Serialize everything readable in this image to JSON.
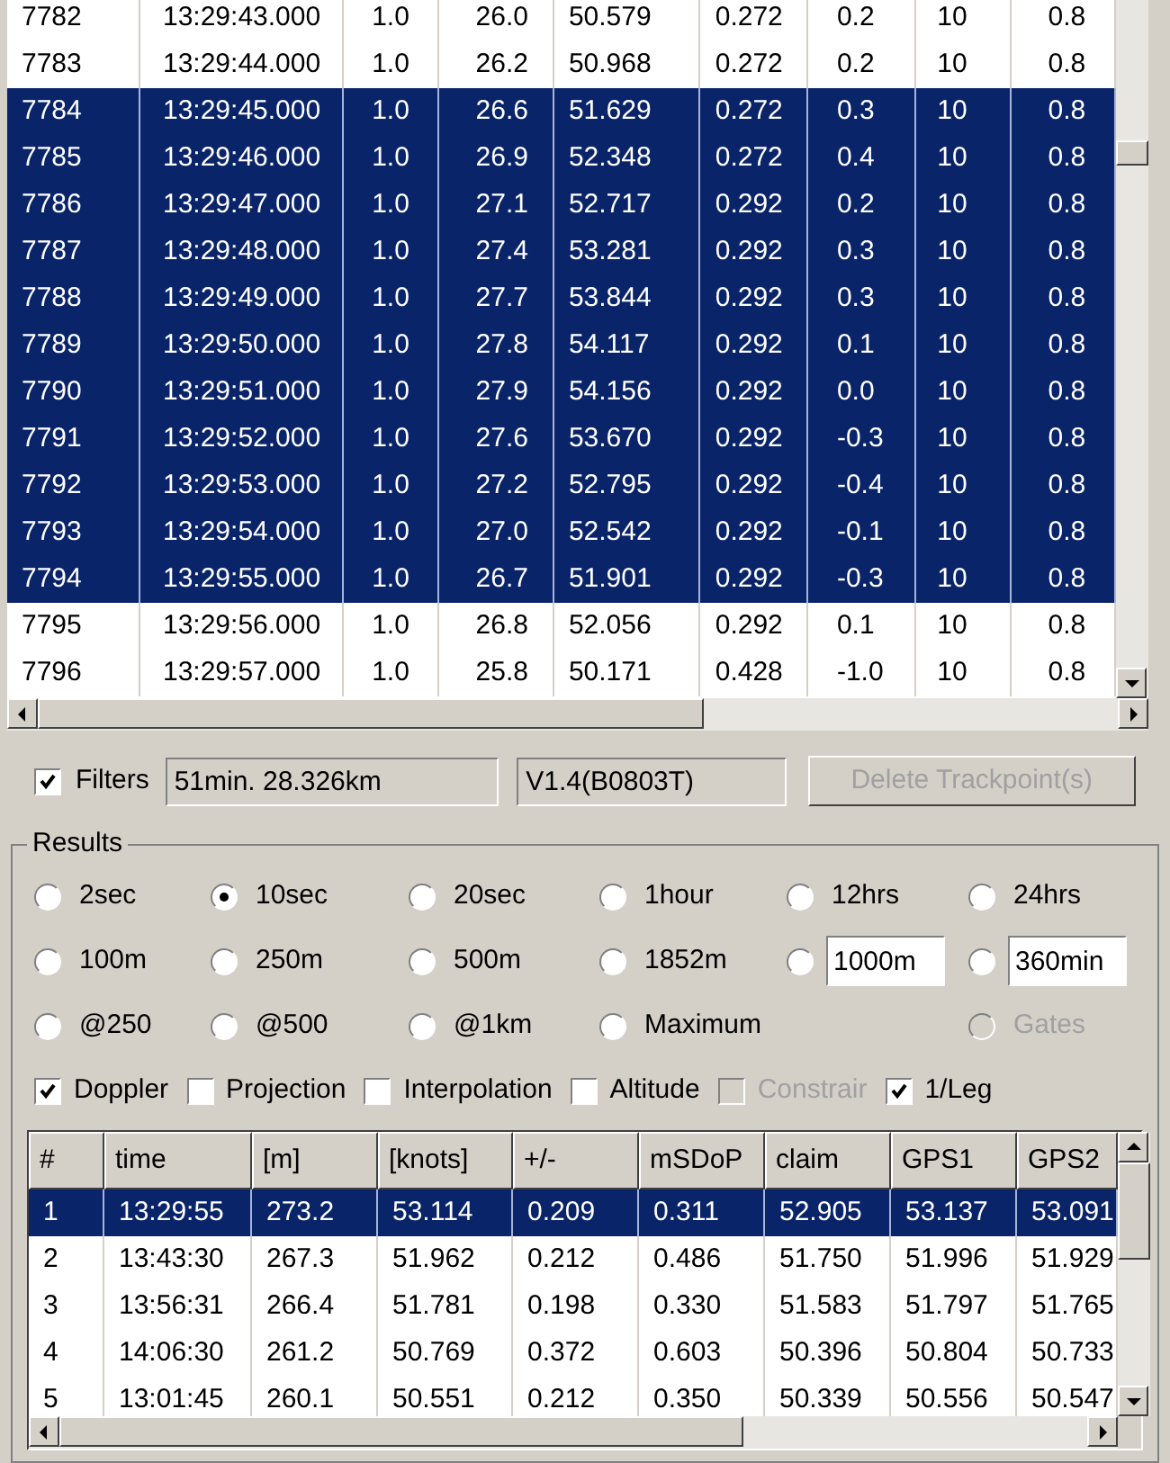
{
  "track_table": {
    "rows": [
      {
        "selected": false,
        "cells": [
          "7782",
          "13:29:43.000",
          "1.0",
          "26.0",
          "50.579",
          "0.272",
          "0.2",
          "10",
          "0.8"
        ]
      },
      {
        "selected": false,
        "cells": [
          "7783",
          "13:29:44.000",
          "1.0",
          "26.2",
          "50.968",
          "0.272",
          "0.2",
          "10",
          "0.8"
        ]
      },
      {
        "selected": true,
        "cells": [
          "7784",
          "13:29:45.000",
          "1.0",
          "26.6",
          "51.629",
          "0.272",
          "0.3",
          "10",
          "0.8"
        ]
      },
      {
        "selected": true,
        "cells": [
          "7785",
          "13:29:46.000",
          "1.0",
          "26.9",
          "52.348",
          "0.272",
          "0.4",
          "10",
          "0.8"
        ]
      },
      {
        "selected": true,
        "cells": [
          "7786",
          "13:29:47.000",
          "1.0",
          "27.1",
          "52.717",
          "0.292",
          "0.2",
          "10",
          "0.8"
        ]
      },
      {
        "selected": true,
        "cells": [
          "7787",
          "13:29:48.000",
          "1.0",
          "27.4",
          "53.281",
          "0.292",
          "0.3",
          "10",
          "0.8"
        ]
      },
      {
        "selected": true,
        "cells": [
          "7788",
          "13:29:49.000",
          "1.0",
          "27.7",
          "53.844",
          "0.292",
          "0.3",
          "10",
          "0.8"
        ]
      },
      {
        "selected": true,
        "cells": [
          "7789",
          "13:29:50.000",
          "1.0",
          "27.8",
          "54.117",
          "0.292",
          "0.1",
          "10",
          "0.8"
        ]
      },
      {
        "selected": true,
        "cells": [
          "7790",
          "13:29:51.000",
          "1.0",
          "27.9",
          "54.156",
          "0.292",
          "0.0",
          "10",
          "0.8"
        ]
      },
      {
        "selected": true,
        "cells": [
          "7791",
          "13:29:52.000",
          "1.0",
          "27.6",
          "53.670",
          "0.292",
          "-0.3",
          "10",
          "0.8"
        ]
      },
      {
        "selected": true,
        "cells": [
          "7792",
          "13:29:53.000",
          "1.0",
          "27.2",
          "52.795",
          "0.292",
          "-0.4",
          "10",
          "0.8"
        ]
      },
      {
        "selected": true,
        "cells": [
          "7793",
          "13:29:54.000",
          "1.0",
          "27.0",
          "52.542",
          "0.292",
          "-0.1",
          "10",
          "0.8"
        ]
      },
      {
        "selected": true,
        "cells": [
          "7794",
          "13:29:55.000",
          "1.0",
          "26.7",
          "51.901",
          "0.292",
          "-0.3",
          "10",
          "0.8"
        ]
      },
      {
        "selected": false,
        "cells": [
          "7795",
          "13:29:56.000",
          "1.0",
          "26.8",
          "52.056",
          "0.292",
          "0.1",
          "10",
          "0.8"
        ]
      },
      {
        "selected": false,
        "cells": [
          "7796",
          "13:29:57.000",
          "1.0",
          "25.8",
          "50.171",
          "0.428",
          "-1.0",
          "10",
          "0.8"
        ]
      }
    ]
  },
  "filters": {
    "label": "Filters",
    "checked": true
  },
  "summary_field": {
    "value": "51min. 28.326km"
  },
  "version_field": {
    "value": "V1.4(B0803T)"
  },
  "delete_button": {
    "label": "Delete Trackpoint(s)",
    "disabled": true
  },
  "results": {
    "title": "Results",
    "options": [
      {
        "kind": "radio",
        "label": "2sec",
        "selected": false,
        "disabled": false
      },
      {
        "kind": "radio",
        "label": "10sec",
        "selected": true,
        "disabled": false
      },
      {
        "kind": "radio",
        "label": "20sec",
        "selected": false,
        "disabled": false
      },
      {
        "kind": "radio",
        "label": "1hour",
        "selected": false,
        "disabled": false
      },
      {
        "kind": "radio",
        "label": "12hrs",
        "selected": false,
        "disabled": false
      },
      {
        "kind": "radio",
        "label": "24hrs",
        "selected": false,
        "disabled": false
      },
      {
        "kind": "radio",
        "label": "100m",
        "selected": false,
        "disabled": false
      },
      {
        "kind": "radio",
        "label": "250m",
        "selected": false,
        "disabled": false
      },
      {
        "kind": "radio",
        "label": "500m",
        "selected": false,
        "disabled": false
      },
      {
        "kind": "radio",
        "label": "1852m",
        "selected": false,
        "disabled": false
      },
      {
        "kind": "input",
        "value": "1000m",
        "selected": false,
        "disabled": false
      },
      {
        "kind": "input",
        "value": "360min",
        "selected": false,
        "disabled": false
      },
      {
        "kind": "radio",
        "label": "@250",
        "selected": false,
        "disabled": false
      },
      {
        "kind": "radio",
        "label": "@500",
        "selected": false,
        "disabled": false
      },
      {
        "kind": "radio",
        "label": "@1km",
        "selected": false,
        "disabled": false
      },
      {
        "kind": "radio",
        "label": "Maximum",
        "selected": false,
        "disabled": false
      },
      {
        "kind": "empty"
      },
      {
        "kind": "radio",
        "label": "Gates",
        "selected": false,
        "disabled": true
      }
    ],
    "checkboxes": [
      {
        "label": "Doppler",
        "checked": true,
        "disabled": false
      },
      {
        "label": "Projection",
        "checked": false,
        "disabled": false
      },
      {
        "label": "Interpolation",
        "checked": false,
        "disabled": false
      },
      {
        "label": "Altitude",
        "checked": false,
        "disabled": false
      },
      {
        "label": "Constrair",
        "checked": false,
        "disabled": true
      },
      {
        "label": "1/Leg",
        "checked": true,
        "disabled": false
      }
    ]
  },
  "results_table": {
    "columns": [
      "#",
      "time",
      "[m]",
      "[knots]",
      "+/-",
      "mSDoP",
      "claim",
      "GPS1",
      "GPS2"
    ],
    "rows": [
      {
        "selected": true,
        "cells": [
          "1",
          "13:29:55",
          "273.2",
          "53.114",
          "0.209",
          "0.311",
          "52.905",
          "53.137",
          "53.091"
        ]
      },
      {
        "selected": false,
        "cells": [
          "2",
          "13:43:30",
          "267.3",
          "51.962",
          "0.212",
          "0.486",
          "51.750",
          "51.996",
          "51.929"
        ]
      },
      {
        "selected": false,
        "cells": [
          "3",
          "13:56:31",
          "266.4",
          "51.781",
          "0.198",
          "0.330",
          "51.583",
          "51.797",
          "51.765"
        ]
      },
      {
        "selected": false,
        "cells": [
          "4",
          "14:06:30",
          "261.2",
          "50.769",
          "0.372",
          "0.603",
          "50.396",
          "50.804",
          "50.733"
        ]
      },
      {
        "selected": false,
        "cells": [
          "5",
          "13:01:45",
          "260.1",
          "50.551",
          "0.212",
          "0.350",
          "50.339",
          "50.556",
          "50.547"
        ]
      }
    ]
  }
}
